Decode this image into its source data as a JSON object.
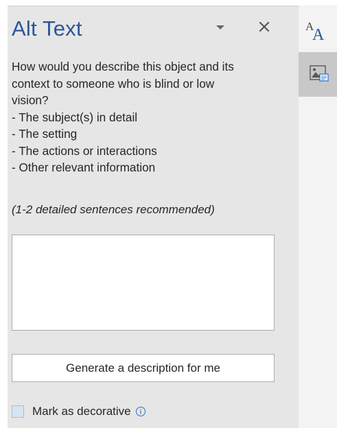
{
  "pane": {
    "title": "Alt Text",
    "dropdown_icon": "chevron-down-icon",
    "close_icon": "close-icon",
    "description_lines": [
      "How would you describe this object and its",
      "context to someone who is blind or low",
      "vision?",
      "- The subject(s) in detail",
      "- The setting",
      "- The actions or interactions",
      "- Other relevant information"
    ],
    "hint": "(1-2 detailed sentences recommended)",
    "alt_text_value": "",
    "generate_button_label": "Generate a description for me",
    "decorative_label": "Mark as decorative",
    "decorative_checked": false,
    "info_icon": "info-icon"
  },
  "rail": {
    "font_icon": "font-size-icon",
    "alt_text_icon": "alt-text-icon",
    "alt_text_selected": true
  },
  "colors": {
    "title": "#2b579a",
    "pane_bg": "#e6e6e6",
    "checkbox_fill": "#d7e4f2",
    "selected_rail": "#c8c8c8"
  }
}
